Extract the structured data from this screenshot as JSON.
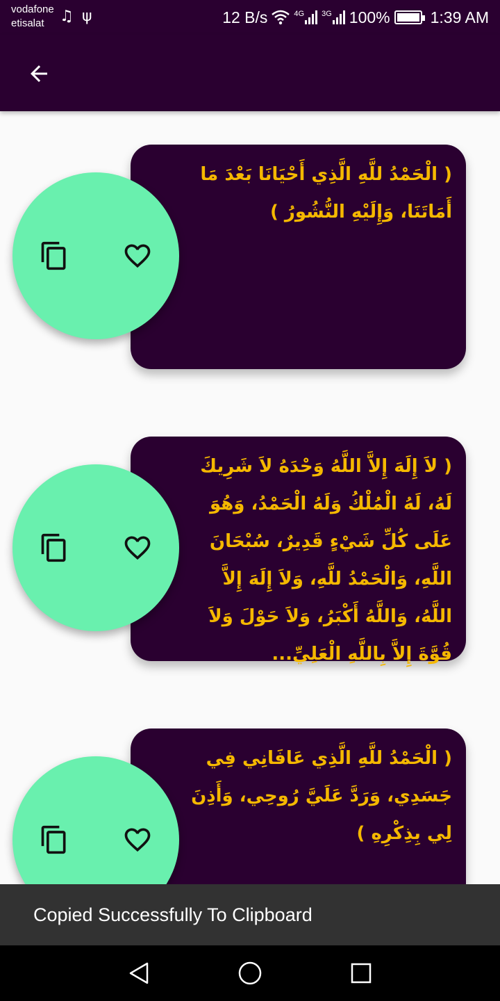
{
  "status_bar": {
    "carrier_line1": "vodafone",
    "carrier_line2": "etisalat",
    "icons_left": [
      "music-icon",
      "usb-icon"
    ],
    "music_glyph": "♫",
    "usb_glyph": "ψ",
    "speed": "12 B/s",
    "network1": "4G",
    "network2": "3G",
    "battery": "100%",
    "time": "1:39 AM"
  },
  "app_bar": {
    "icon": "arrow-back-icon"
  },
  "cards": [
    {
      "text": "( الْحَمْدُ للَّهِ الَّذِي أَحْيَانَا بَعْدَ مَا أَمَاتَنَا، وَإِلَيْهِ النُّشُورُ )"
    },
    {
      "text": "( لاَ إِلَهَ إِلاَّ اللَّهُ وَحْدَهُ لاَ شَرِيكَ لَهُ، لَهُ الْمُلْكُ وَلَهُ الْحَمْدُ، وَهُوَ عَلَى كُلِّ شَيْءٍ قَدِيرٌ، سُبْحَانَ اللَّهِ، وَالْحَمْدُ للَّهِ، وَلاَ إِلَهَ إِلاَّ اللَّهُ، وَاللَّهُ أَكْبَرُ، وَلاَ حَوْلَ وَلاَ قُوَّةَ إِلاَّ بِاللَّهِ الْعَلِيِّ..."
    },
    {
      "text": "( الْحَمْدُ للَّهِ الَّذِي عَافَانِي فِي جَسَدِي، وَرَدَّ عَلَيَّ رُوحِي، وَأَذِنَ لِي بِذِكْرِهِ )"
    }
  ],
  "card_icons": {
    "copy": "copy-icon",
    "favorite": "heart-outline-icon"
  },
  "toast": {
    "message": "Copied Successfully To Clipboard"
  },
  "nav_bar": {
    "icons": [
      "back-triangle-icon",
      "home-circle-icon",
      "recents-square-icon"
    ]
  },
  "colors": {
    "app_bar": "#2a0030",
    "card_background": "#2a0030",
    "card_text": "#f5b800",
    "accent_circle": "#69f0ae",
    "page_background": "#fafafa",
    "toast_background": "#323232"
  }
}
